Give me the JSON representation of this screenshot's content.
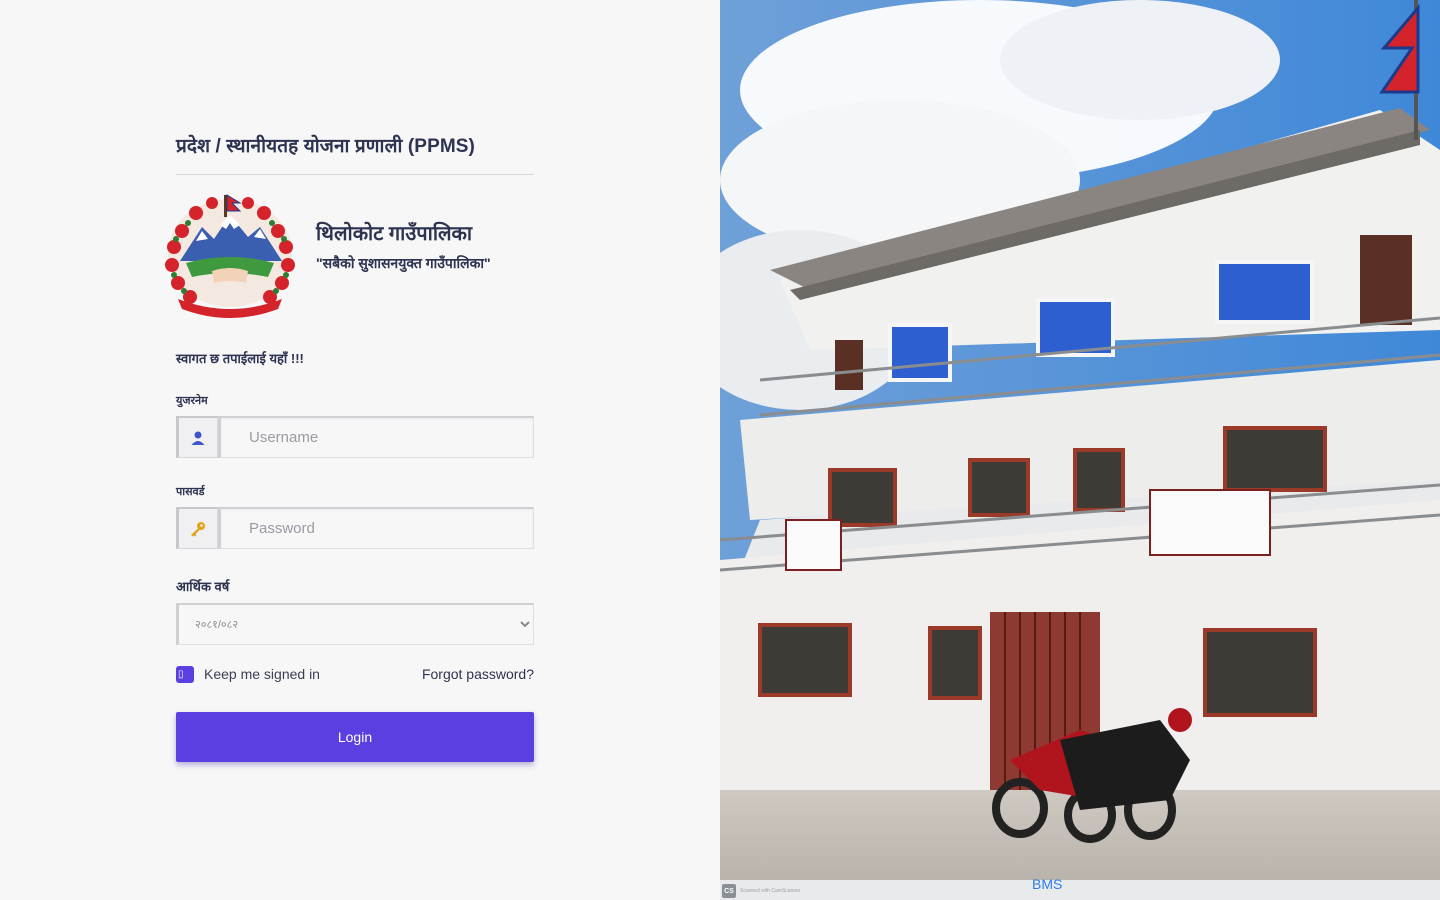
{
  "header": {
    "system_title": "प्रदेश / स्थानीयतह योजना प्रणाली",
    "system_abbr": "(PPMS)"
  },
  "organization": {
    "name": "थिलोकोट गाउँपालिका",
    "motto": "\"सबैको सुशासनयुक्त गाउँपालिका\""
  },
  "login": {
    "welcome": "स्वागत छ तपाईलाई यहाँ",
    "welcome_suffix": "!!!",
    "username_label": "युजरनेम",
    "username_placeholder": "Username",
    "password_label": "पासवर्ड",
    "password_placeholder": "Password",
    "fiscal_year_label": "आर्थिक वर्ष",
    "fiscal_year_selected": "२०८१/०८२",
    "remember_label": "Keep me signed in",
    "forgot_label": "Forgot password?",
    "submit_label": "Login"
  },
  "footer": {
    "brand": "BMS",
    "scanner_note": "Scanned with CamScanner",
    "scanner_logo": "CS"
  },
  "icons": {
    "username": "user-icon",
    "password": "key-icon",
    "checkbox": "check-icon"
  },
  "colors": {
    "primary": "#5b3fe0",
    "title": "#2d3350",
    "link": "#2f7de8"
  }
}
